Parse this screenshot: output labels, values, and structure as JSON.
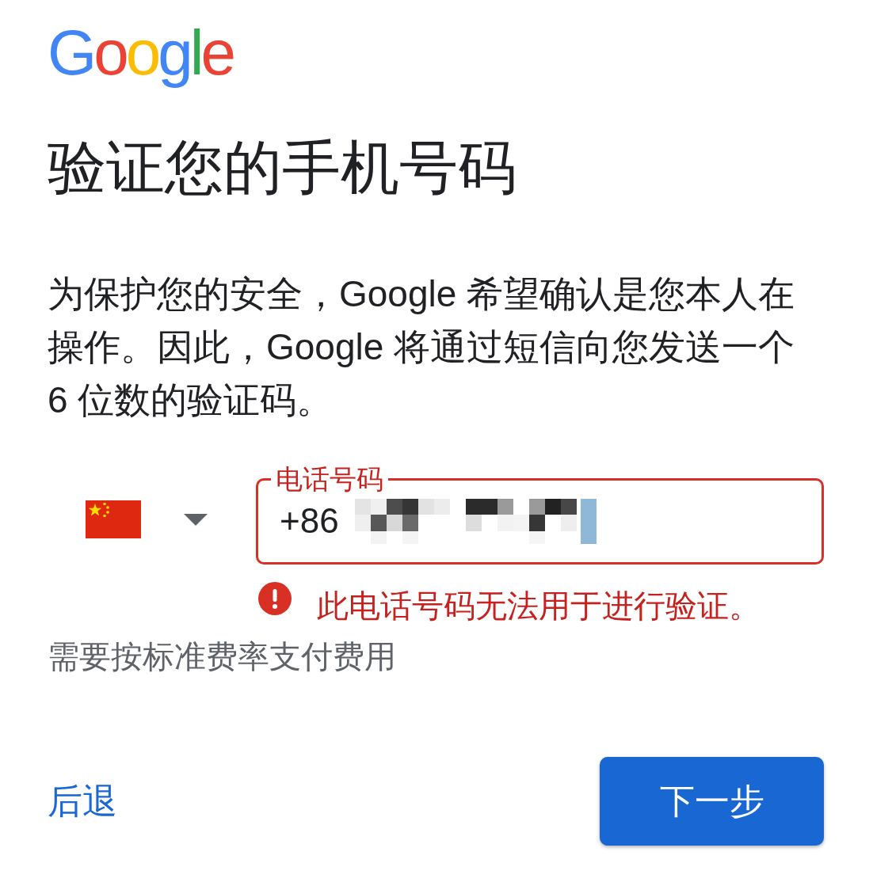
{
  "logo": "Google",
  "title": "验证您的手机号码",
  "description": "为保护您的安全，Google 希望确认是您本人在操作。因此，Google 将通过短信向您发送一个 6 位数的验证码。",
  "phone_field": {
    "label": "电话号码",
    "value": "+86",
    "invalid": true,
    "redacted": true,
    "error": "此电话号码无法用于进行验证。"
  },
  "note": "需要按标准费率支付费用",
  "actions": [
    {
      "kind": "text",
      "label": "后退"
    },
    {
      "kind": "filled",
      "label": "下一步"
    }
  ]
}
